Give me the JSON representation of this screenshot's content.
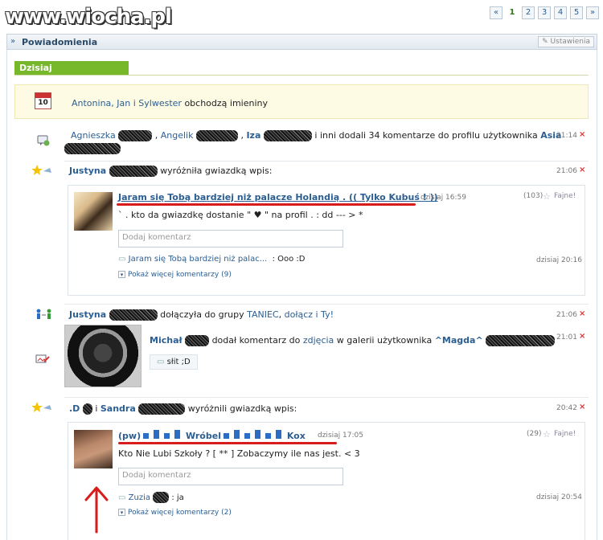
{
  "watermark": "www.wiocha.pl",
  "pager": [
    "«",
    "1",
    "2",
    "3",
    "4",
    "5",
    "»"
  ],
  "header": {
    "title": "Powiadomienia",
    "settings": "Ustawienia"
  },
  "today": "Dzisiaj",
  "nameday": {
    "names": "Antonina, Jan i Sylwester",
    "text": "obchodzą imieniny",
    "calendar": "10"
  },
  "n1": {
    "a": "Agnieszka",
    "sep1": ",",
    "b": "Angelik",
    "sep2": ",",
    "c": "Iza",
    "rest": "i inni dodali 34 komentarze do profilu użytkownika",
    "user": "Asia",
    "time": "21:14"
  },
  "n2": {
    "user": "Justyna",
    "text": "wyróżniła gwiazdką wpis:",
    "time": "21:06",
    "post": {
      "title": "Jaram się Tobą bardziej niż palacze Holandią . (( Tylko Kubuś ! ))",
      "date": "dzisiaj 16:59",
      "count": "(103)",
      "fajne": "Fajne!",
      "body": "` . kto da gwiazdkę dostanie \" ♥ \" na profil . : dd --- > *",
      "input": "Dodaj komentarz",
      "c_title": "Jaram się Tobą bardziej niż palac...",
      "c_text": ": Ooo :D",
      "c_time": "dzisiaj 20:16",
      "more": "Pokaż więcej komentarzy",
      "more_count": "(9)"
    }
  },
  "n3": {
    "user": "Justyna",
    "text": "dołączyła do grupy",
    "group": "TANIEC",
    "join": "dołącz i Ty!",
    "time": "21:06"
  },
  "n4": {
    "user": "Michał",
    "text": "dodał komentarz do",
    "photo": "zdjęcia",
    "text2": "w galerii użytkownika",
    "owner": "^Magda^",
    "time": "21:01",
    "comment": "słit ;D"
  },
  "n5": {
    "user1": ".D",
    "and": "i",
    "user2": "Sandra",
    "text": "wyróżnili gwiazdką wpis:",
    "time": "20:42",
    "post": {
      "prefix": "(pw)",
      "name1": "Wróbel",
      "name2": "Kox",
      "date": "dzisiaj 17:05",
      "count": "(29)",
      "fajne": "Fajne!",
      "body": "Kto Nie Lubi Szkoły ? [ ** ] Zobaczymy ile nas jest. < 3",
      "input": "Dodaj komentarz",
      "c_user": "Zuzia",
      "c_text": ": ja",
      "c_time": "dzisiaj 20:54",
      "more": "Pokaż więcej komentarzy",
      "more_count": "(2)"
    }
  },
  "x": "×"
}
